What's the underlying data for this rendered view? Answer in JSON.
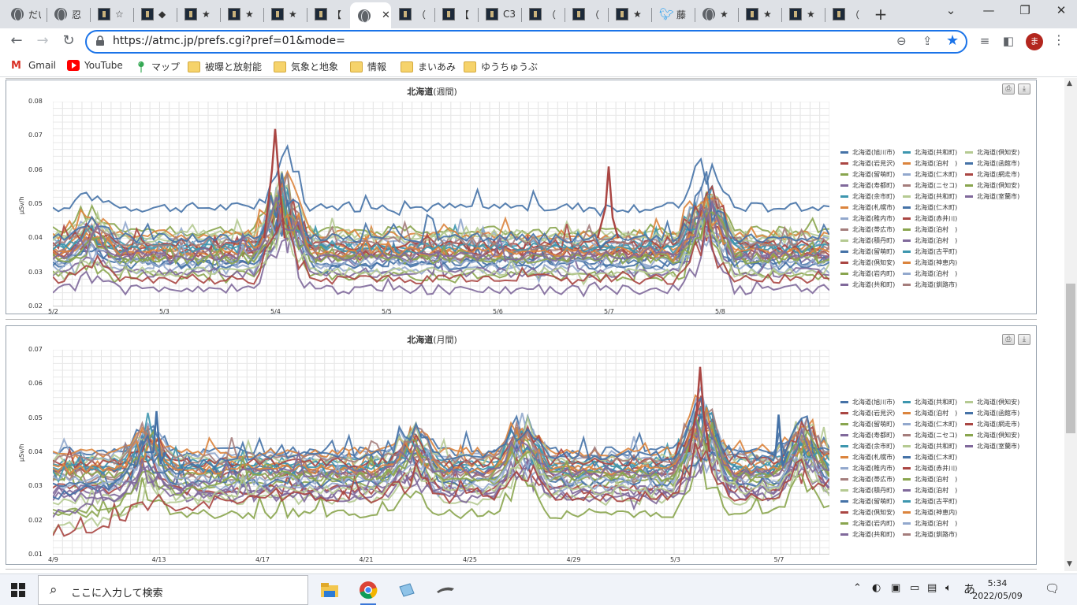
{
  "browser": {
    "tabs": [
      {
        "title": "だい",
        "icon": "globe-icon",
        "active": false
      },
      {
        "title": "忍",
        "icon": "globe-icon",
        "active": false
      },
      {
        "title": "☆",
        "icon": "site-logo-icon",
        "active": false
      },
      {
        "title": "◆",
        "icon": "site-logo-icon",
        "active": false
      },
      {
        "title": "★",
        "icon": "site-logo-icon",
        "active": false
      },
      {
        "title": "★",
        "icon": "site-logo-icon",
        "active": false
      },
      {
        "title": "★",
        "icon": "site-logo-icon",
        "active": false
      },
      {
        "title": "【",
        "icon": "site-logo-icon",
        "active": false
      },
      {
        "title": "",
        "icon": "globe-icon",
        "active": true
      },
      {
        "title": "（",
        "icon": "site-logo-icon",
        "active": false
      },
      {
        "title": "【",
        "icon": "site-logo-icon",
        "active": false
      },
      {
        "title": "C3",
        "icon": "site-logo-icon",
        "active": false
      },
      {
        "title": "（",
        "icon": "site-logo-icon",
        "active": false
      },
      {
        "title": "（",
        "icon": "site-logo-icon",
        "active": false
      },
      {
        "title": "★",
        "icon": "site-logo-icon",
        "active": false
      },
      {
        "title": "藤",
        "icon": "twitter-icon",
        "active": false
      },
      {
        "title": "★",
        "icon": "globe-icon",
        "active": false
      },
      {
        "title": "★",
        "icon": "site-logo-icon",
        "active": false
      },
      {
        "title": "★",
        "icon": "site-logo-icon",
        "active": false
      },
      {
        "title": "（",
        "icon": "site-logo-icon",
        "active": false
      }
    ],
    "new_tab": "+",
    "close_tab": "✕",
    "url": "https://atmc.jp/prefs.cgi?pref=01&mode=",
    "profile_initial": "ま",
    "bookmarks": [
      {
        "label": "Gmail",
        "icon": "gmail-icon"
      },
      {
        "label": "YouTube",
        "icon": "youtube-icon"
      },
      {
        "label": "マップ",
        "icon": "maps-icon"
      },
      {
        "label": "被曝と放射能",
        "icon": "folder-icon"
      },
      {
        "label": "気象と地象",
        "icon": "folder-icon"
      },
      {
        "label": "情報",
        "icon": "folder-icon"
      },
      {
        "label": "まいあみ",
        "icon": "folder-icon"
      },
      {
        "label": "ゆうちゅうぶ",
        "icon": "folder-icon"
      }
    ]
  },
  "charts_meta": {
    "legend": [
      "北海道(旭川市)",
      "北海道(岩見沢)",
      "北海道(留萌町)",
      "北海道(寿都町)",
      "北海道(余市町)",
      "北海道(札幌市)",
      "北海道(稚内市)",
      "北海道(帯広市)",
      "北海道(積丹町)",
      "北海道(留萌町)",
      "北海道(倶知安)",
      "北海道(岩内町)",
      "北海道(共和町)",
      "北海道(共和町)",
      "北海道(泊村　)",
      "北海道(仁木町)",
      "北海道(ニセコ)",
      "北海道(共和町)",
      "北海道(仁木町)",
      "北海道(赤井川)",
      "北海道(泊村　)",
      "北海道(泊村　)",
      "北海道(古平町)",
      "北海道(神恵内)",
      "北海道(泊村　)",
      "北海道(釧路市)",
      "北海道(倶知安)",
      "北海道(函館市)",
      "北海道(網走市)",
      "北海道(倶知安)",
      "北海道(室蘭市)"
    ],
    "legend_colors": [
      "#4572a7",
      "#aa4643",
      "#89a54e",
      "#80699b",
      "#3d96ae",
      "#db843d",
      "#92a8cd",
      "#a47d7c",
      "#b5ca92",
      "#4572a7",
      "#aa4643",
      "#89a54e",
      "#80699b",
      "#3d96ae",
      "#db843d",
      "#92a8cd",
      "#a47d7c",
      "#b5ca92",
      "#4572a7",
      "#aa4643",
      "#89a54e",
      "#80699b",
      "#3d96ae",
      "#db843d",
      "#92a8cd",
      "#a47d7c",
      "#b5ca92",
      "#4572a7",
      "#aa4643",
      "#89a54e",
      "#80699b"
    ],
    "print_icon": "print-icon",
    "download_icon": "download-icon"
  },
  "chart_data": [
    {
      "type": "line",
      "title": "北海道",
      "subtitle": "(週間)",
      "ylabel": "μSv/h",
      "ylim": [
        0.02,
        0.08
      ],
      "yticks": [
        "0.08",
        "0.07",
        "0.06",
        "0.05",
        "0.04",
        "0.03",
        "0.02"
      ],
      "xticks": [
        "5/2",
        "5/3",
        "5/4",
        "5/5",
        "5/6",
        "5/7",
        "5/8"
      ],
      "n_points": 140,
      "series_base_levels": [
        0.049,
        0.035,
        0.042,
        0.034,
        0.038,
        0.037,
        0.039,
        0.035,
        0.041,
        0.033,
        0.036,
        0.029,
        0.025,
        0.037,
        0.041,
        0.031,
        0.036,
        0.04,
        0.032,
        0.038,
        0.034,
        0.03,
        0.037,
        0.036,
        0.033,
        0.039,
        0.03,
        0.04,
        0.028,
        0.034,
        0.035
      ],
      "peaks": [
        {
          "x": "5/4",
          "value": 0.072,
          "series": "北海道(倶知安)"
        },
        {
          "x": "5/7",
          "value": 0.061,
          "series": "北海道(岩見沢)"
        }
      ]
    },
    {
      "type": "line",
      "title": "北海道",
      "subtitle": "(月間)",
      "ylabel": "μSv/h",
      "ylim": [
        0.01,
        0.07
      ],
      "yticks": [
        "0.07",
        "0.06",
        "0.05",
        "0.04",
        "0.03",
        "0.02",
        "0.01"
      ],
      "xticks": [
        "4/9",
        "4/13",
        "4/17",
        "4/21",
        "4/25",
        "4/29",
        "5/3",
        "5/7"
      ],
      "n_points": 140,
      "series_base_levels": [
        0.04,
        0.034,
        0.031,
        0.028,
        0.037,
        0.036,
        0.039,
        0.033,
        0.026,
        0.035,
        0.029,
        0.022,
        0.027,
        0.036,
        0.04,
        0.03,
        0.034,
        0.038,
        0.031,
        0.037,
        0.033,
        0.029,
        0.035,
        0.035,
        0.032,
        0.038,
        0.029,
        0.039,
        0.027,
        0.033,
        0.034
      ],
      "peaks": [
        {
          "x": "5/3",
          "value": 0.065,
          "series": "北海道(倶知安)"
        },
        {
          "x": "4/13",
          "value": 0.052,
          "series": "北海道(旭川市)"
        },
        {
          "x": "5/7",
          "value": 0.051,
          "series": "北海道(旭川市)"
        }
      ]
    }
  ],
  "taskbar": {
    "search_placeholder": "ここに入力して検索",
    "time": "5:34",
    "date": "2022/05/09",
    "ime": "あ"
  }
}
